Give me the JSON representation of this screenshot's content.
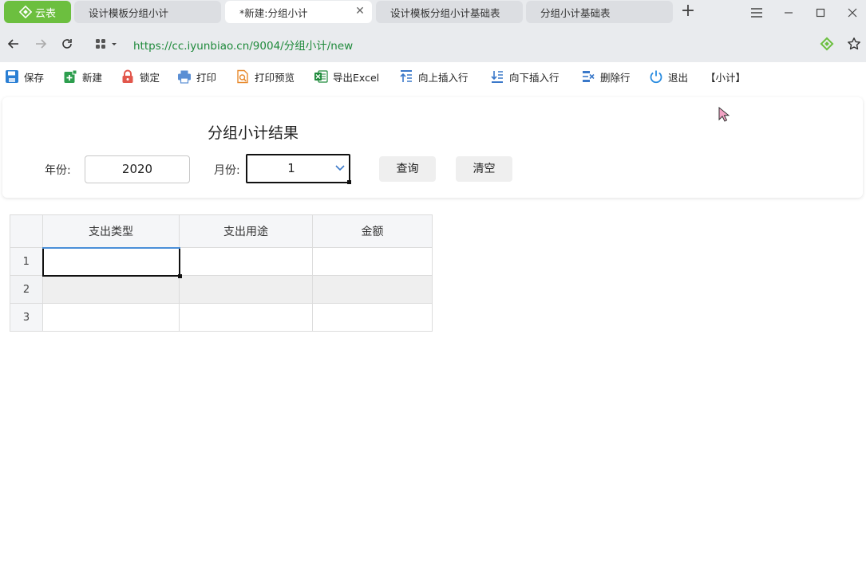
{
  "browser": {
    "brand_tab": "云表",
    "tabs": [
      {
        "label": "设计模板分组小计"
      },
      {
        "label": "*新建:分组小计",
        "close": "✕"
      },
      {
        "label": "设计模板分组小计基础表"
      },
      {
        "label": "分组小计基础表"
      }
    ],
    "new_tab": "+",
    "url": "https://cc.iyunbiao.cn/9004/分组小计/new"
  },
  "toolbar": {
    "save": "保存",
    "new": "新建",
    "lock": "锁定",
    "print": "打印",
    "print_preview": "打印预览",
    "export_excel": "导出Excel",
    "insert_above": "向上插入行",
    "insert_below": "向下插入行",
    "delete_row": "删除行",
    "exit": "退出",
    "subtotal": "【小计】"
  },
  "panel": {
    "title": "分组小计结果",
    "year_label": "年份:",
    "year_value": "2020",
    "month_label": "月份:",
    "month_value": "1",
    "query_button": "查询",
    "clear_button": "清空"
  },
  "grid": {
    "columns": [
      "支出类型",
      "支出用途",
      "金额"
    ],
    "rows": [
      {
        "no": "1",
        "cells": [
          "",
          "",
          ""
        ]
      },
      {
        "no": "2",
        "cells": [
          "",
          "",
          ""
        ]
      },
      {
        "no": "3",
        "cells": [
          "",
          "",
          ""
        ]
      }
    ]
  },
  "colors": {
    "brand": "#6cbf3f",
    "url": "#1f8a3b",
    "header_accent": "#4a8fd8"
  }
}
